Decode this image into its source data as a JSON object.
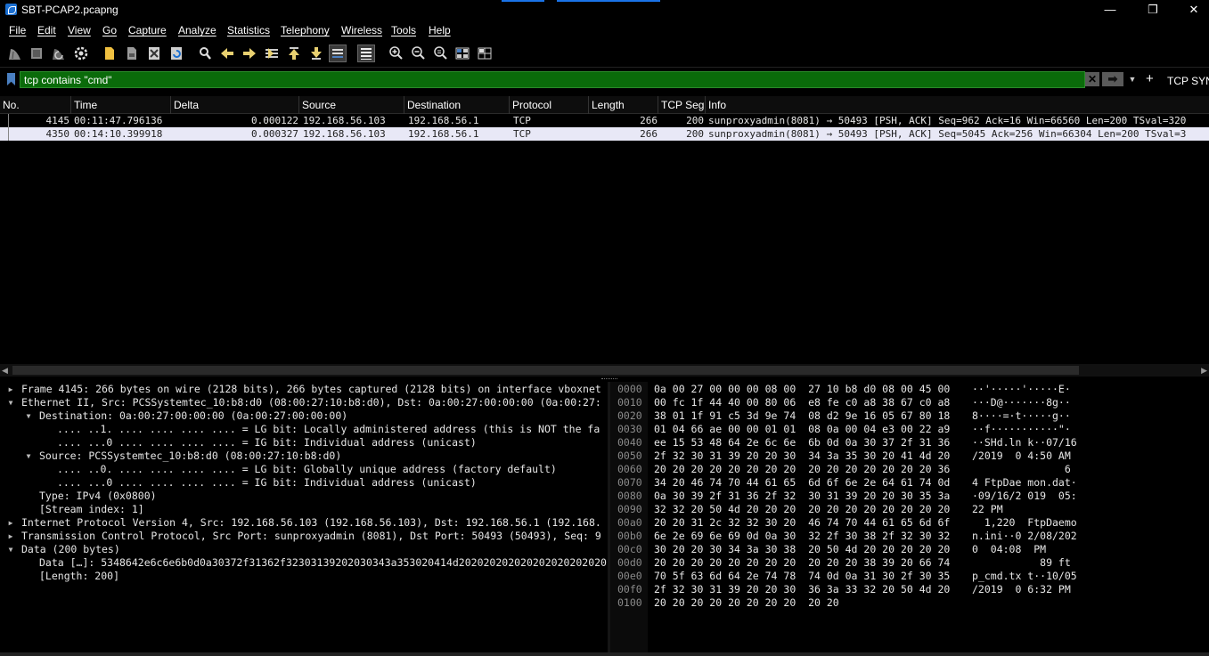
{
  "window": {
    "title": "SBT-PCAP2.pcapng",
    "minimize_glyph": "—",
    "restore_glyph": "❐",
    "close_glyph": "✕"
  },
  "menu": [
    "File",
    "Edit",
    "View",
    "Go",
    "Capture",
    "Analyze",
    "Statistics",
    "Telephony",
    "Wireless",
    "Tools",
    "Help"
  ],
  "toolbar_icons": [
    "shark-fin-start-icon",
    "stop-icon",
    "restart-icon",
    "capture-options-icon",
    "open-file-icon",
    "save-file-icon",
    "close-file-icon",
    "reload-icon",
    "find-packet-icon",
    "go-back-icon",
    "go-forward-icon",
    "go-to-packet-icon",
    "go-first-icon",
    "go-last-icon",
    "autoscroll-icon",
    "colorize-icon",
    "zoom-in-icon",
    "zoom-out-icon",
    "normal-size-icon",
    "resize-columns-icon",
    "expand-all-icon"
  ],
  "filter": {
    "value": "tcp contains \"cmd\"",
    "clear_glyph": "✕",
    "apply_glyph": "➡",
    "dropdown_glyph": "▼",
    "add_glyph": "+",
    "button_label": "TCP SYN"
  },
  "packet_list": {
    "columns": [
      "No.",
      "Time",
      "Delta",
      "Source",
      "Destination",
      "Protocol",
      "Length",
      "TCP Seg",
      "Info"
    ],
    "rows": [
      {
        "no": "4145",
        "time": "00:11:47.796136",
        "delta": "0.000122",
        "source": "192.168.56.103",
        "destination": "192.168.56.1",
        "protocol": "TCP",
        "length": "266",
        "tcp_seg": "200",
        "info": "sunproxyadmin(8081) → 50493 [PSH, ACK] Seq=962 Ack=16 Win=66560 Len=200 TSval=320",
        "selected": false
      },
      {
        "no": "4350",
        "time": "00:14:10.399918",
        "delta": "0.000327",
        "source": "192.168.56.103",
        "destination": "192.168.56.1",
        "protocol": "TCP",
        "length": "266",
        "tcp_seg": "200",
        "info": "sunproxyadmin(8081) → 50493 [PSH, ACK] Seq=5045 Ack=256 Win=66304 Len=200 TSval=3",
        "selected": true
      }
    ]
  },
  "details": {
    "lines": [
      {
        "twisty": "collapsed",
        "text": "Frame 4145: 266 bytes on wire (2128 bits), 266 bytes captured (2128 bits) on interface vboxnet"
      },
      {
        "twisty": "expanded",
        "text": "Ethernet II, Src: PCSSystemtec_10:b8:d0 (08:00:27:10:b8:d0), Dst: 0a:00:27:00:00:00 (0a:00:27:"
      },
      {
        "twisty": "expanded",
        "text": "Destination: 0a:00:27:00:00:00 (0a:00:27:00:00:00)"
      },
      {
        "twisty": "",
        "text": ".... ..1. .... .... .... .... = LG bit: Locally administered address (this is NOT the fa"
      },
      {
        "twisty": "",
        "text": ".... ...0 .... .... .... .... = IG bit: Individual address (unicast)"
      },
      {
        "twisty": "expanded",
        "text": "Source: PCSSystemtec_10:b8:d0 (08:00:27:10:b8:d0)"
      },
      {
        "twisty": "",
        "text": ".... ..0. .... .... .... .... = LG bit: Globally unique address (factory default)"
      },
      {
        "twisty": "",
        "text": ".... ...0 .... .... .... .... = IG bit: Individual address (unicast)"
      },
      {
        "twisty": "",
        "text": "Type: IPv4 (0x0800)"
      },
      {
        "twisty": "",
        "text": "[Stream index: 1]"
      },
      {
        "twisty": "collapsed",
        "text": "Internet Protocol Version 4, Src: 192.168.56.103 (192.168.56.103), Dst: 192.168.56.1 (192.168."
      },
      {
        "twisty": "collapsed",
        "text": "Transmission Control Protocol, Src Port: sunproxyadmin (8081), Dst Port: 50493 (50493), Seq: 9"
      },
      {
        "twisty": "expanded",
        "text": "Data (200 bytes)"
      },
      {
        "twisty": "",
        "text": "Data […]: 5348642e6c6e6b0d0a30372f31362f32303139202030343a353020414d202020202020202020202020"
      },
      {
        "twisty": "",
        "text": "[Length: 200]"
      }
    ]
  },
  "bytes": {
    "rows": [
      {
        "off": "0000",
        "hex": "0a 00 27 00 00 00 08 00  27 10 b8 d0 08 00 45 00",
        "ascii": "··'·····'·····E·"
      },
      {
        "off": "0010",
        "hex": "00 fc 1f 44 40 00 80 06  e8 fe c0 a8 38 67 c0 a8",
        "ascii": "···D@·······8g··"
      },
      {
        "off": "0020",
        "hex": "38 01 1f 91 c5 3d 9e 74  08 d2 9e 16 05 67 80 18",
        "ascii": "8····=·t·····g··"
      },
      {
        "off": "0030",
        "hex": "01 04 66 ae 00 00 01 01  08 0a 00 04 e3 00 22 a9",
        "ascii": "··f···········\"·"
      },
      {
        "off": "0040",
        "hex": "ee 15 53 48 64 2e 6c 6e  6b 0d 0a 30 37 2f 31 36",
        "ascii": "··SHd.ln k··07/16"
      },
      {
        "off": "0050",
        "hex": "2f 32 30 31 39 20 20 30  34 3a 35 30 20 41 4d 20",
        "ascii": "/2019  0 4:50 AM "
      },
      {
        "off": "0060",
        "hex": "20 20 20 20 20 20 20 20  20 20 20 20 20 20 20 36",
        "ascii": "               6"
      },
      {
        "off": "0070",
        "hex": "34 20 46 74 70 44 61 65  6d 6f 6e 2e 64 61 74 0d",
        "ascii": "4 FtpDae mon.dat·"
      },
      {
        "off": "0080",
        "hex": "0a 30 39 2f 31 36 2f 32  30 31 39 20 20 30 35 3a",
        "ascii": "·09/16/2 019  05:"
      },
      {
        "off": "0090",
        "hex": "32 32 20 50 4d 20 20 20  20 20 20 20 20 20 20 20",
        "ascii": "22 PM           "
      },
      {
        "off": "00a0",
        "hex": "20 20 31 2c 32 32 30 20  46 74 70 44 61 65 6d 6f",
        "ascii": "  1,220  FtpDaemo"
      },
      {
        "off": "00b0",
        "hex": "6e 2e 69 6e 69 0d 0a 30  32 2f 30 38 2f 32 30 32",
        "ascii": "n.ini··0 2/08/202"
      },
      {
        "off": "00c0",
        "hex": "30 20 20 30 34 3a 30 38  20 50 4d 20 20 20 20 20",
        "ascii": "0  04:08  PM     "
      },
      {
        "off": "00d0",
        "hex": "20 20 20 20 20 20 20 20  20 20 20 38 39 20 66 74",
        "ascii": "           89 ft"
      },
      {
        "off": "00e0",
        "hex": "70 5f 63 6d 64 2e 74 78  74 0d 0a 31 30 2f 30 35",
        "ascii": "p_cmd.tx t··10/05"
      },
      {
        "off": "00f0",
        "hex": "2f 32 30 31 39 20 20 30  36 3a 33 32 20 50 4d 20",
        "ascii": "/2019  0 6:32 PM "
      },
      {
        "off": "0100",
        "hex": "20 20 20 20 20 20 20 20  20 20",
        "ascii": ""
      }
    ]
  },
  "colors": {
    "filter_valid_bg": "#0a6b0a",
    "selected_row_bg": "#e8e8f6",
    "background": "#000000"
  }
}
